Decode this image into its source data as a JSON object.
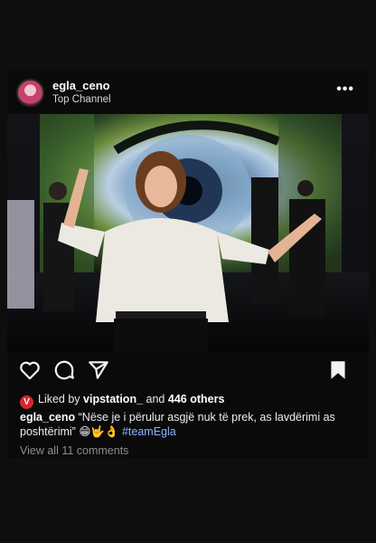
{
  "post": {
    "username": "egla_ceno",
    "subtitle": "Top Channel",
    "more_icon": "more-horizontal-icon"
  },
  "actions": {
    "like_icon": "heart-icon",
    "comment_icon": "comment-icon",
    "share_icon": "send-icon",
    "save_icon": "bookmark-icon"
  },
  "likes": {
    "badge": "V",
    "prefix": "Liked by",
    "user": "vipstation_",
    "conjunction": "and",
    "others": "446 others"
  },
  "caption": {
    "username": "egla_ceno",
    "text": "“Nëse je i përulur asgjë nuk të prek, as lavdërimi as poshtërimi”",
    "emojis": "😁🤟👌",
    "hashtag": "#teamEgla"
  },
  "comments": {
    "label": "View all 11 comments"
  },
  "colors": {
    "background": "#0e0e0e",
    "hashtag": "#8fb2ff",
    "badge": "#d7262b"
  }
}
